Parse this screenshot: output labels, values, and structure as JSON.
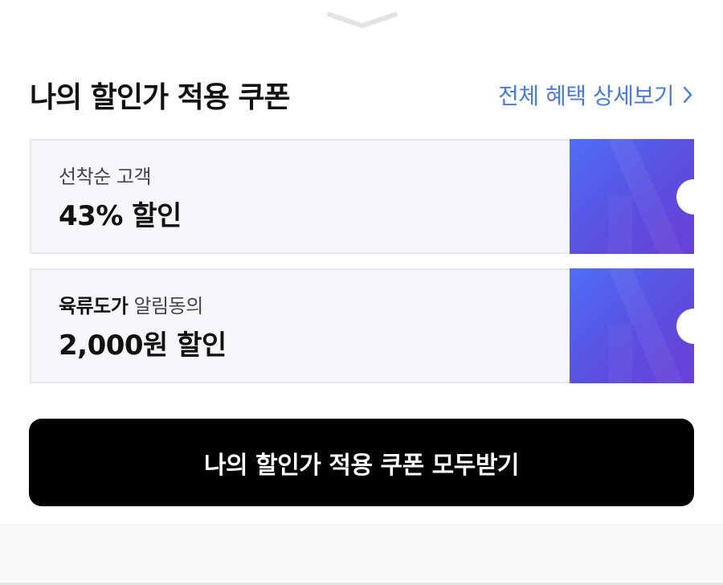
{
  "sheet": {
    "handle_icon": "chevron-down-handle"
  },
  "header": {
    "title": "나의 할인가 적용 쿠폰",
    "detail_link": "전체 혜택 상세보기",
    "detail_icon": "chevron-right-icon",
    "accent_color": "#4a7be0"
  },
  "coupons": [
    {
      "subtitle": "선착순 고객",
      "discount": "43% 할인"
    },
    {
      "subtitle_bold": "육류도가",
      "subtitle_rest": " 알림동의",
      "discount": "2,000원 할인"
    }
  ],
  "coupon_stub_color": "#5b5ce8",
  "cta": {
    "label": "나의 할인가 적용 쿠폰 모두받기",
    "background": "#000000"
  }
}
